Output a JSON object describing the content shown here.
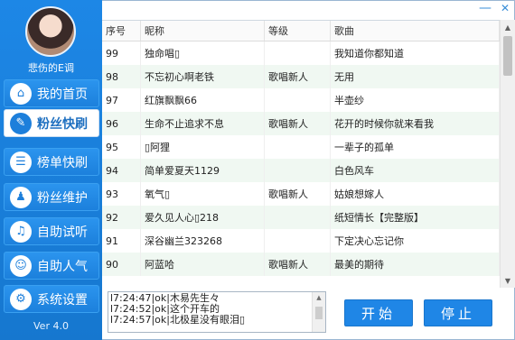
{
  "window": {
    "minimize_symbol": "—",
    "close_symbol": "✕"
  },
  "sidebar": {
    "username": "悲伤的E调",
    "version": "Ver 4.0",
    "items": [
      {
        "label": "我的首页",
        "icon": "home-icon",
        "glyph": "⌂",
        "active": false
      },
      {
        "label": "粉丝快刷",
        "icon": "tag-icon",
        "glyph": "✎",
        "active": true
      },
      {
        "label": "榜单快刷",
        "icon": "list-icon",
        "glyph": "☰",
        "active": false
      },
      {
        "label": "粉丝维护",
        "icon": "users-icon",
        "glyph": "♟",
        "active": false
      },
      {
        "label": "自助试听",
        "icon": "music-icon",
        "glyph": "♫",
        "active": false
      },
      {
        "label": "自助人气",
        "icon": "people-icon",
        "glyph": "☺",
        "active": false
      },
      {
        "label": "系统设置",
        "icon": "gear-icon",
        "glyph": "⚙",
        "active": false
      }
    ]
  },
  "table": {
    "headers": [
      "序号",
      "昵称",
      "等级",
      "歌曲"
    ],
    "rows": [
      {
        "no": "99",
        "nick": "独命唱▯",
        "level": "",
        "song": "我知道你都知道"
      },
      {
        "no": "98",
        "nick": "不忘初心啊老铁",
        "level": "歌唱新人",
        "song": "无用"
      },
      {
        "no": "97",
        "nick": "红旗飘飘66",
        "level": "",
        "song": "半壶纱"
      },
      {
        "no": "96",
        "nick": "生命不止追求不息",
        "level": "歌唱新人",
        "song": "花开的时候你就来看我"
      },
      {
        "no": "95",
        "nick": "▯阿狸",
        "level": "",
        "song": "一辈子的孤单"
      },
      {
        "no": "94",
        "nick": "简单爱夏天1129",
        "level": "",
        "song": "白色风车"
      },
      {
        "no": "93",
        "nick": "氧气▯",
        "level": "歌唱新人",
        "song": "姑娘想嫁人"
      },
      {
        "no": "92",
        "nick": "爱久见人心▯218",
        "level": "",
        "song": "纸短情长【完整版】"
      },
      {
        "no": "91",
        "nick": "深谷幽兰323268",
        "level": "",
        "song": "下定决心忘记你"
      },
      {
        "no": "90",
        "nick": "阿蓝哈",
        "level": "歌唱新人",
        "song": "最美的期待"
      }
    ]
  },
  "log": [
    "l7:24:47|ok|木易先生々",
    "l7:24:52|ok|这个开车的",
    "l7:24:57|ok|北极星没有眼泪▯"
  ],
  "buttons": {
    "start": "开始",
    "stop": "停止"
  },
  "colors": {
    "sidebar": "#1d87e6",
    "accent": "#1f86e6",
    "row_alt": "#f0f8f2"
  }
}
